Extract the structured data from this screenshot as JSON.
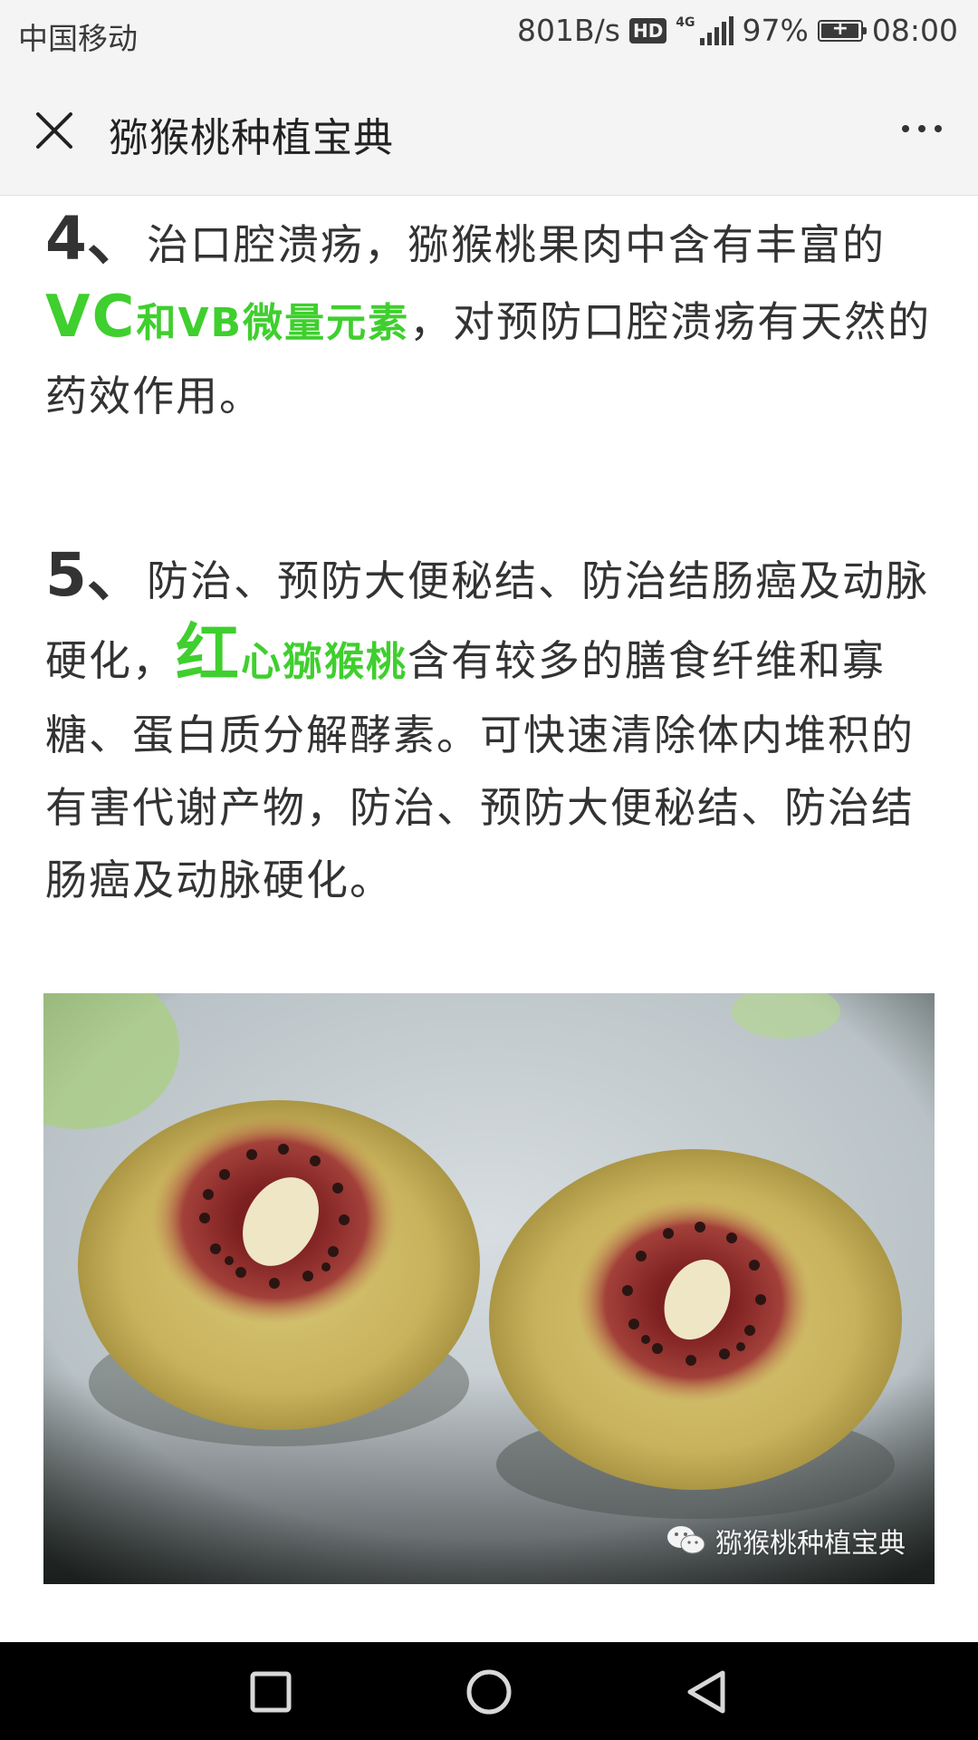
{
  "status_bar": {
    "carrier": "中国移动",
    "net_speed": "801B/s",
    "hd_badge": "HD",
    "network_type": "4G",
    "battery_percent": "97%",
    "battery_level": 0.97,
    "time": "08:00"
  },
  "header": {
    "title": "猕猴桃种植宝典"
  },
  "article": {
    "item4": {
      "number": "4、",
      "text_a": "治口腔溃疡，猕猴桃果肉中含有丰富的",
      "hl_vc": "VC",
      "hl_he": "和",
      "hl_vb": "VB微量元素",
      "text_b": "，对预防口腔溃疡有天然的药效作用。"
    },
    "item5": {
      "number": "5、",
      "text_a": "防治、预防大便秘结、防治结肠癌及动脉硬化，",
      "hl_hong": "红",
      "hl_rest": "心猕猴桃",
      "text_b": "含有较多的膳食纤维和寡糖、蛋白质分解酵素。可快速清除体内堆积的有害代谢产物，防治、预防大便秘结、防治结肠癌及动脉硬化。"
    },
    "image": {
      "watermark": "猕猴桃种植宝典",
      "icon": "wechat-icon"
    }
  },
  "colors": {
    "highlight_green": "#3fcf2e",
    "bar_bg": "#f4f4f4",
    "nav_bg": "#000000"
  },
  "nav_bar": {
    "icons": [
      "recent-apps-icon",
      "home-icon",
      "back-icon"
    ]
  }
}
